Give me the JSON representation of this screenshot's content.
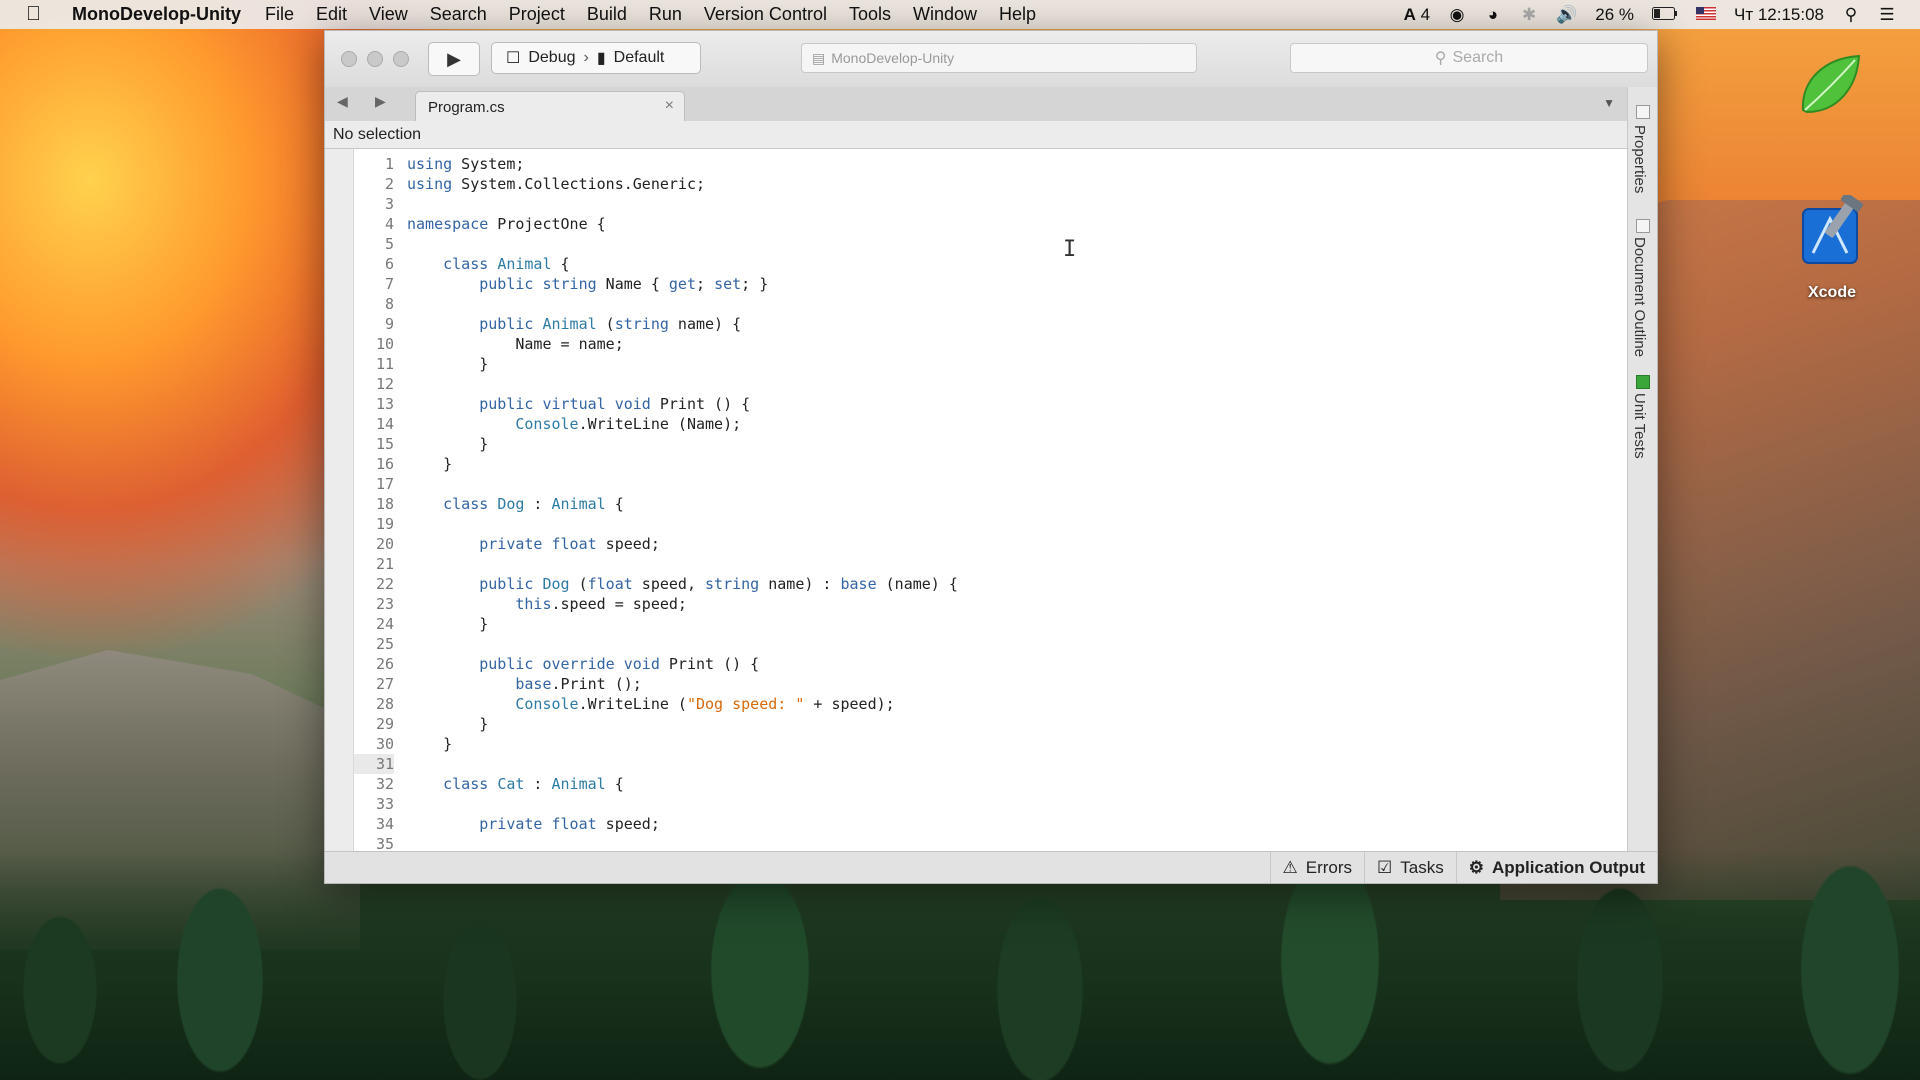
{
  "menubar": {
    "app_name": "MonoDevelop-Unity",
    "items": [
      "File",
      "Edit",
      "View",
      "Search",
      "Project",
      "Build",
      "Run",
      "Version Control",
      "Tools",
      "Window",
      "Help"
    ],
    "tray": {
      "adobe": "4",
      "battery": "26 %",
      "datetime": "Чт 12:15:08"
    }
  },
  "toolbar": {
    "config": "Debug",
    "target": "Default",
    "status": "MonoDevelop-Unity",
    "search_placeholder": "Search"
  },
  "tab": {
    "label": "Program.cs",
    "close": "×"
  },
  "pathbar": {
    "text": "No selection"
  },
  "editor": {
    "line_numbers": [
      "1",
      "2",
      "3",
      "4",
      "5",
      "6",
      "7",
      "8",
      "9",
      "10",
      "11",
      "12",
      "13",
      "14",
      "15",
      "16",
      "17",
      "18",
      "19",
      "20",
      "21",
      "22",
      "23",
      "24",
      "25",
      "26",
      "27",
      "28",
      "29",
      "30",
      "31",
      "32",
      "33",
      "34",
      "35"
    ],
    "active_line": "31"
  },
  "statusbar": {
    "errors": "Errors",
    "tasks": "Tasks",
    "output": "Application Output"
  },
  "sidepanel": {
    "properties": "Properties",
    "outline": "Document Outline",
    "unit_tests": "Unit Tests"
  },
  "desktop": {
    "xcode_label": "Xcode"
  },
  "code_lines": [
    [
      [
        "kw",
        "using"
      ],
      [
        "",
        " System;"
      ]
    ],
    [
      [
        "kw",
        "using"
      ],
      [
        "",
        " System.Collections.Generic;"
      ]
    ],
    [],
    [
      [
        "kw",
        "namespace"
      ],
      [
        "",
        " ProjectOne {"
      ]
    ],
    [],
    [
      [
        "",
        "    "
      ],
      [
        "kw",
        "class"
      ],
      [
        "",
        " "
      ],
      [
        "ty",
        "Animal"
      ],
      [
        "",
        " {"
      ]
    ],
    [
      [
        "",
        "        "
      ],
      [
        "kw",
        "public"
      ],
      [
        "",
        " "
      ],
      [
        "kw",
        "string"
      ],
      [
        "",
        " Name { "
      ],
      [
        "kw",
        "get"
      ],
      [
        "",
        "; "
      ],
      [
        "kw",
        "set"
      ],
      [
        "",
        "; }"
      ]
    ],
    [],
    [
      [
        "",
        "        "
      ],
      [
        "kw",
        "public"
      ],
      [
        "",
        " "
      ],
      [
        "ty",
        "Animal"
      ],
      [
        "",
        " ("
      ],
      [
        "kw",
        "string"
      ],
      [
        "",
        " name) {"
      ]
    ],
    [
      [
        "",
        "            Name = name;"
      ]
    ],
    [
      [
        "",
        "        }"
      ]
    ],
    [],
    [
      [
        "",
        "        "
      ],
      [
        "kw",
        "public"
      ],
      [
        "",
        " "
      ],
      [
        "kw",
        "virtual"
      ],
      [
        "",
        " "
      ],
      [
        "kw",
        "void"
      ],
      [
        "",
        " Print () {"
      ]
    ],
    [
      [
        "",
        "            "
      ],
      [
        "ty",
        "Console"
      ],
      [
        "",
        ".WriteLine (Name);"
      ]
    ],
    [
      [
        "",
        "        }"
      ]
    ],
    [
      [
        "",
        "    }"
      ]
    ],
    [],
    [
      [
        "",
        "    "
      ],
      [
        "kw",
        "class"
      ],
      [
        "",
        " "
      ],
      [
        "ty",
        "Dog"
      ],
      [
        "",
        " : "
      ],
      [
        "ty",
        "Animal"
      ],
      [
        "",
        " {"
      ]
    ],
    [],
    [
      [
        "",
        "        "
      ],
      [
        "kw",
        "private"
      ],
      [
        "",
        " "
      ],
      [
        "kw",
        "float"
      ],
      [
        "",
        " speed;"
      ]
    ],
    [],
    [
      [
        "",
        "        "
      ],
      [
        "kw",
        "public"
      ],
      [
        "",
        " "
      ],
      [
        "ty",
        "Dog"
      ],
      [
        "",
        " ("
      ],
      [
        "kw",
        "float"
      ],
      [
        "",
        " speed, "
      ],
      [
        "kw",
        "string"
      ],
      [
        "",
        " name) : "
      ],
      [
        "kw",
        "base"
      ],
      [
        "",
        " (name) {"
      ]
    ],
    [
      [
        "",
        "            "
      ],
      [
        "kw",
        "this"
      ],
      [
        "",
        ".speed = speed;"
      ]
    ],
    [
      [
        "",
        "        }"
      ]
    ],
    [],
    [
      [
        "",
        "        "
      ],
      [
        "kw",
        "public"
      ],
      [
        "",
        " "
      ],
      [
        "kw",
        "override"
      ],
      [
        "",
        " "
      ],
      [
        "kw",
        "void"
      ],
      [
        "",
        " Print () {"
      ]
    ],
    [
      [
        "",
        "            "
      ],
      [
        "kw",
        "base"
      ],
      [
        "",
        ".Print ();"
      ]
    ],
    [
      [
        "",
        "            "
      ],
      [
        "ty",
        "Console"
      ],
      [
        "",
        ".WriteLine ("
      ],
      [
        "str",
        "\"Dog speed: \""
      ],
      [
        "",
        " + speed);"
      ]
    ],
    [
      [
        "",
        "        }"
      ]
    ],
    [
      [
        "",
        "    }"
      ]
    ],
    [],
    [
      [
        "",
        "    "
      ],
      [
        "kw",
        "class"
      ],
      [
        "",
        " "
      ],
      [
        "ty",
        "Cat"
      ],
      [
        "",
        " : "
      ],
      [
        "ty",
        "Animal"
      ],
      [
        "",
        " {"
      ]
    ],
    [],
    [
      [
        "",
        "        "
      ],
      [
        "kw",
        "private"
      ],
      [
        "",
        " "
      ],
      [
        "kw",
        "float"
      ],
      [
        "",
        " speed;"
      ]
    ],
    []
  ]
}
